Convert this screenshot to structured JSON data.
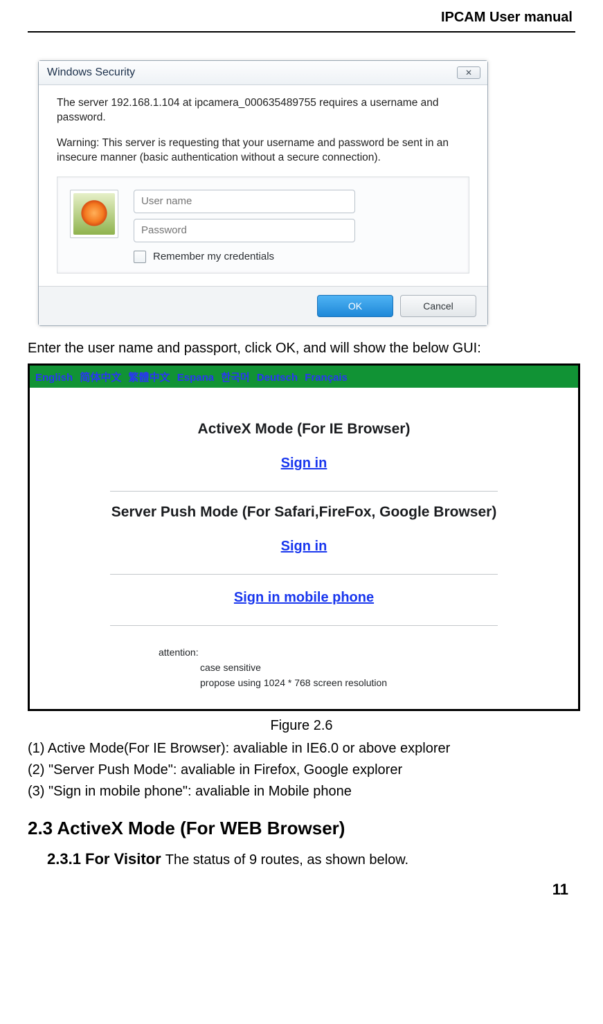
{
  "header": {
    "title": "IPCAM User manual"
  },
  "dialog": {
    "title": "Windows Security",
    "msg1": "The server 192.168.1.104 at ipcamera_000635489755 requires a username and password.",
    "msg2": "Warning: This server is requesting that your username and password be sent in an insecure manner (basic authentication without a secure connection).",
    "username_placeholder": "User name",
    "password_placeholder": "Password",
    "remember_label": "Remember my credentials",
    "ok_label": "OK",
    "cancel_label": "Cancel"
  },
  "body_after_dialog": "Enter the user name and passport, click OK, and will show the below GUI:",
  "langbar": {
    "english": "English",
    "simpchinese": "简体中文",
    "tradchinese": "繁體中文",
    "espana": "Espana",
    "korean": "한국머",
    "deutsch": "Deutsch",
    "francais": "Français"
  },
  "webpage": {
    "mode1_title": "ActiveX Mode (For IE Browser)",
    "signin1": "Sign in",
    "mode2_title": "Server Push Mode (For Safari,FireFox, Google Browser)",
    "signin2": "Sign in",
    "signin_mobile": "Sign in mobile phone",
    "attn_label": "attention:",
    "attn_line1": "case sensitive",
    "attn_line2": "propose using 1024 * 768 screen resolution"
  },
  "figure_caption": "Figure 2.6",
  "list": {
    "l1": "(1) Active Mode(For IE Browser): avaliable in IE6.0 or above explorer",
    "l2": "(2) \"Server Push Mode\": avaliable in Firefox, Google explorer",
    "l3": "(3) \"Sign in mobile phone\": avaliable in Mobile phone"
  },
  "section_2_3": "2.3  ActiveX Mode (For WEB Browser)",
  "section_2_3_1_bold": "2.3.1 For Visitor ",
  "section_2_3_1_trail": "The status of 9 routes, as shown below.",
  "page_number": "11"
}
